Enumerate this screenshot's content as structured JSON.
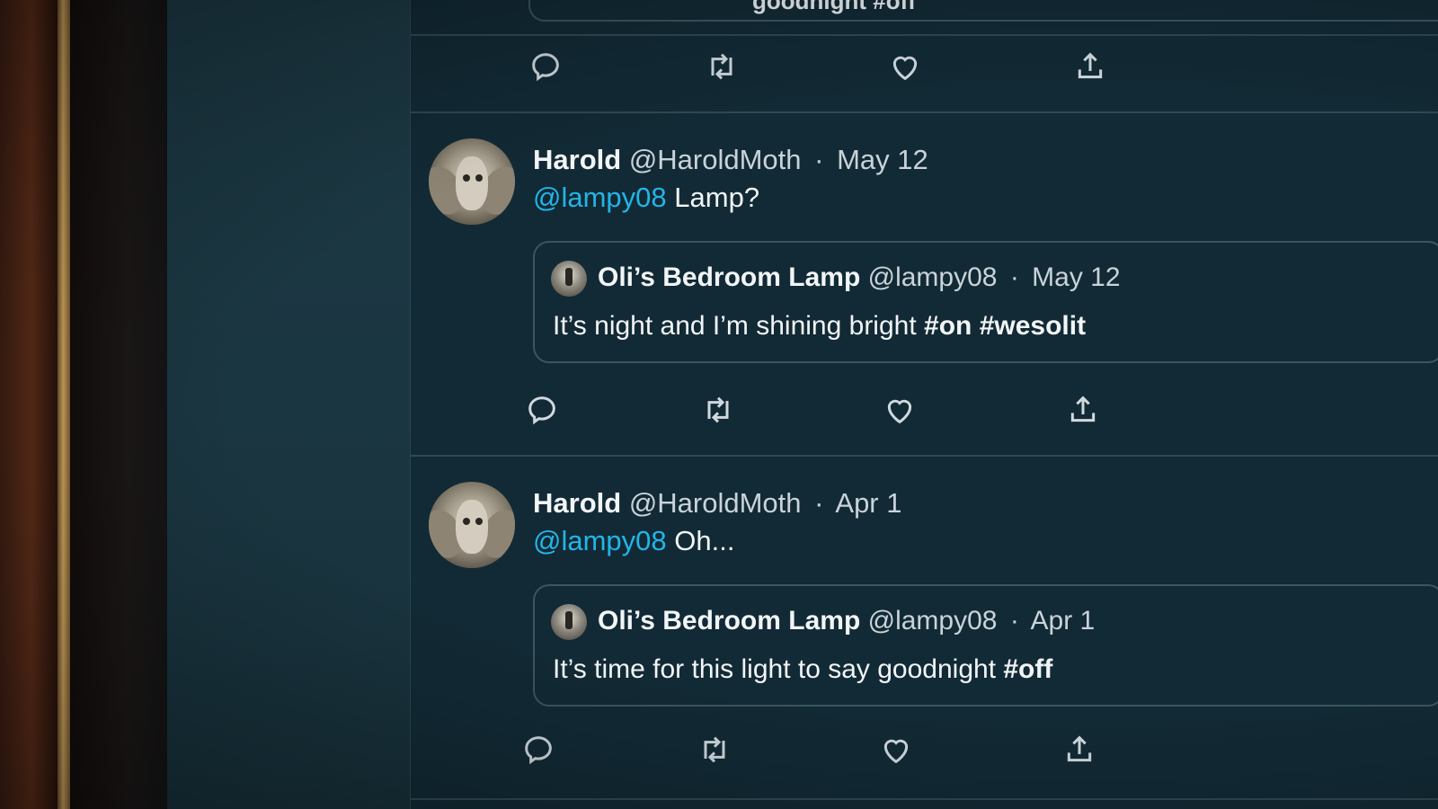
{
  "top_tweet": {
    "quote_text_fragment": "goodnight #off",
    "actions": [
      "reply-icon",
      "retweet-icon",
      "like-icon",
      "share-icon"
    ]
  },
  "tweets": [
    {
      "name": "Harold",
      "handle": "@HaroldMoth",
      "separator": "·",
      "date": "May 12",
      "mention": "@lampy08",
      "text": "Lamp?",
      "quote": {
        "name": "Oli’s Bedroom Lamp",
        "handle": "@lampy08",
        "separator": "·",
        "date": "May 12",
        "text": "It’s night and I’m shining bright #on #wesolit"
      }
    },
    {
      "name": "Harold",
      "handle": "@HaroldMoth",
      "separator": "·",
      "date": "Apr 1",
      "mention": "@lampy08",
      "text": "Oh...",
      "quote": {
        "name": "Oli’s Bedroom Lamp",
        "handle": "@lampy08",
        "separator": "·",
        "date": "Apr 1",
        "text": "It’s time for this light to say goodnight #off"
      }
    }
  ],
  "colors": {
    "background": "#122a35",
    "mention": "#23b5e8",
    "text": "#f2f5f7",
    "muted": "#c9d3d9"
  }
}
